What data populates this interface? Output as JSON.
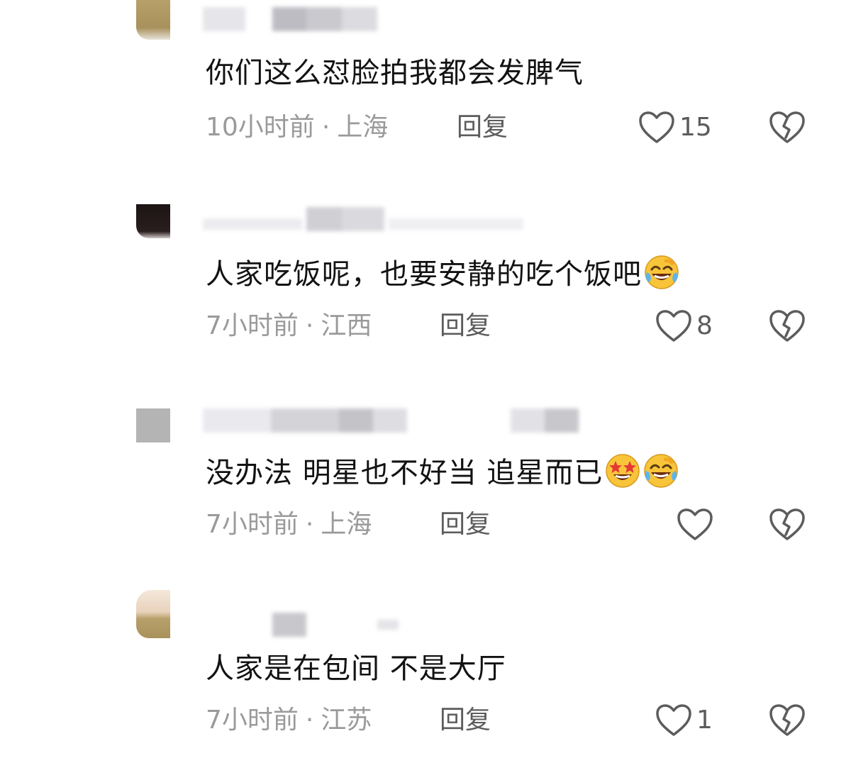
{
  "comments": [
    {
      "text": "你们这么怼脸拍我都会发脾气",
      "time": "10小时前",
      "location": "上海",
      "reply_label": "回复",
      "likes": "15"
    },
    {
      "text": "人家吃饭呢，也要安静的吃个饭吧",
      "emojis": [
        "laughing-crying-face"
      ],
      "time": "7小时前",
      "location": "江西",
      "reply_label": "回复",
      "likes": "8"
    },
    {
      "text": "没办法 明星也不好当 追星而已",
      "emojis": [
        "star-struck-face",
        "laughing-crying-face"
      ],
      "time": "7小时前",
      "location": "上海",
      "reply_label": "回复",
      "likes": ""
    },
    {
      "text": "人家是在包间 不是大厅",
      "time": "7小时前",
      "location": "江苏",
      "reply_label": "回复",
      "likes": "1"
    }
  ],
  "meta_separator": "·",
  "icons": {
    "like": "heart-outline-icon",
    "dislike": "broken-heart-icon"
  },
  "colors": {
    "text": "#121212",
    "meta": "#9a9a9a",
    "action": "#5c5c5c",
    "emoji_face": "#f7c43a"
  }
}
